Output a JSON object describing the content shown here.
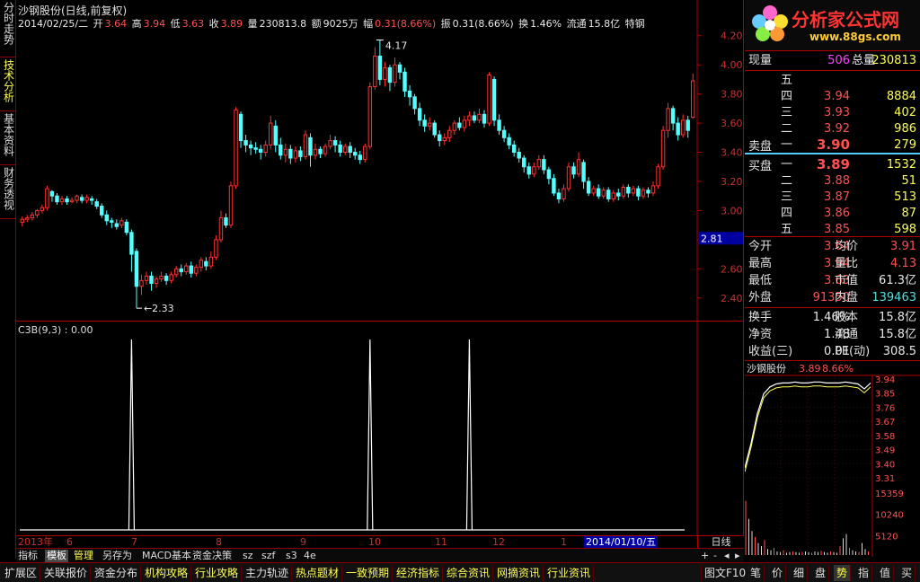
{
  "left_tabs": [
    "分时走势",
    "技术分析",
    "基本资料",
    "财务透视"
  ],
  "header": {
    "title": "沙钢股份(日线,前复权)",
    "date": "2014/02/25/二",
    "open_label": "开",
    "open": "3.64",
    "high_label": "高",
    "high": "3.94",
    "low_label": "低",
    "low": "3.63",
    "close_label": "收",
    "close": "3.89",
    "volume_label": "量",
    "volume": "230813.8",
    "amount_label": "额",
    "amount": "9025万",
    "range_label": "幅",
    "range": "0.31(8.66%)",
    "amplitude_label": "振",
    "amplitude": "0.31(8.66%)",
    "turnover_label": "换",
    "turnover": "1.46%",
    "float_label": "流通",
    "float": "15.8亿",
    "sector": "特钢"
  },
  "kline": {
    "price_axis": [
      "4.20",
      "4.00",
      "3.80",
      "3.60",
      "3.40",
      "3.20",
      "3.00",
      "2.80",
      "2.60",
      "2.40"
    ],
    "ylim": [
      2.3,
      4.26
    ],
    "high_mark": "4.17",
    "low_mark": "2.33",
    "cursor_price": "2.81",
    "candles": [
      [
        2.92,
        2.94,
        2.96,
        2.89
      ],
      [
        2.94,
        2.95,
        2.97,
        2.92
      ],
      [
        2.95,
        2.97,
        2.99,
        2.93
      ],
      [
        2.97,
        3.0,
        3.01,
        2.95
      ],
      [
        3.0,
        3.02,
        3.04,
        2.98
      ],
      [
        3.02,
        3.15,
        3.17,
        3.0
      ],
      [
        3.13,
        3.1,
        3.14,
        3.06
      ],
      [
        3.1,
        3.06,
        3.12,
        3.04
      ],
      [
        3.06,
        3.08,
        3.1,
        3.04
      ],
      [
        3.08,
        3.06,
        3.1,
        3.04
      ],
      [
        3.06,
        3.07,
        3.09,
        3.05
      ],
      [
        3.07,
        3.1,
        3.11,
        3.05
      ],
      [
        3.09,
        3.07,
        3.11,
        3.05
      ],
      [
        3.07,
        3.09,
        3.11,
        3.05
      ],
      [
        3.08,
        3.07,
        3.1,
        3.04
      ],
      [
        3.06,
        3.03,
        3.08,
        3.01
      ],
      [
        3.03,
        2.97,
        3.05,
        2.95
      ],
      [
        2.97,
        2.93,
        3.0,
        2.9
      ],
      [
        2.93,
        2.92,
        2.95,
        2.88
      ],
      [
        2.91,
        2.89,
        2.94,
        2.87
      ],
      [
        2.9,
        2.93,
        2.95,
        2.88
      ],
      [
        2.92,
        2.85,
        2.94,
        2.83
      ],
      [
        2.85,
        2.7,
        2.87,
        2.58
      ],
      [
        2.72,
        2.48,
        2.74,
        2.33
      ],
      [
        2.48,
        2.52,
        2.56,
        2.42
      ],
      [
        2.52,
        2.55,
        2.58,
        2.49
      ],
      [
        2.55,
        2.5,
        2.58,
        2.45
      ],
      [
        2.5,
        2.53,
        2.55,
        2.47
      ],
      [
        2.53,
        2.55,
        2.58,
        2.51
      ],
      [
        2.55,
        2.52,
        2.57,
        2.49
      ],
      [
        2.52,
        2.56,
        2.58,
        2.5
      ],
      [
        2.56,
        2.6,
        2.62,
        2.54
      ],
      [
        2.6,
        2.58,
        2.63,
        2.55
      ],
      [
        2.58,
        2.62,
        2.64,
        2.56
      ],
      [
        2.62,
        2.57,
        2.65,
        2.54
      ],
      [
        2.57,
        2.61,
        2.63,
        2.55
      ],
      [
        2.61,
        2.66,
        2.68,
        2.58
      ],
      [
        2.65,
        2.62,
        2.68,
        2.59
      ],
      [
        2.62,
        2.68,
        2.72,
        2.6
      ],
      [
        2.68,
        2.8,
        2.83,
        2.66
      ],
      [
        2.8,
        2.95,
        3.0,
        2.78
      ],
      [
        2.95,
        2.9,
        2.98,
        2.88
      ],
      [
        2.9,
        3.17,
        3.2,
        2.88
      ],
      [
        3.17,
        3.69,
        3.71,
        3.15
      ],
      [
        3.66,
        3.48,
        3.68,
        3.43
      ],
      [
        3.48,
        3.45,
        3.52,
        3.4
      ],
      [
        3.45,
        3.43,
        3.48,
        3.38
      ],
      [
        3.43,
        3.42,
        3.47,
        3.39
      ],
      [
        3.42,
        3.4,
        3.45,
        3.35
      ],
      [
        3.4,
        3.45,
        3.48,
        3.37
      ],
      [
        3.45,
        3.6,
        3.65,
        3.42
      ],
      [
        3.58,
        3.45,
        3.62,
        3.4
      ],
      [
        3.45,
        3.38,
        3.5,
        3.35
      ],
      [
        3.38,
        3.42,
        3.46,
        3.33
      ],
      [
        3.42,
        3.36,
        3.45,
        3.32
      ],
      [
        3.36,
        3.41,
        3.44,
        3.33
      ],
      [
        3.41,
        3.37,
        3.44,
        3.34
      ],
      [
        3.37,
        3.52,
        3.55,
        3.35
      ],
      [
        3.5,
        3.38,
        3.53,
        3.3
      ],
      [
        3.38,
        3.42,
        3.46,
        3.35
      ],
      [
        3.42,
        3.39,
        3.44,
        3.36
      ],
      [
        3.39,
        3.44,
        3.46,
        3.37
      ],
      [
        3.44,
        3.48,
        3.52,
        3.42
      ],
      [
        3.48,
        3.45,
        3.51,
        3.4
      ],
      [
        3.45,
        3.4,
        3.48,
        3.37
      ],
      [
        3.4,
        3.44,
        3.46,
        3.38
      ],
      [
        3.44,
        3.4,
        3.47,
        3.36
      ],
      [
        3.4,
        3.38,
        3.43,
        3.35
      ],
      [
        3.38,
        3.35,
        3.41,
        3.32
      ],
      [
        3.35,
        3.44,
        3.46,
        3.33
      ],
      [
        3.44,
        3.85,
        3.88,
        3.42
      ],
      [
        3.85,
        4.06,
        4.12,
        3.83
      ],
      [
        4.06,
        3.9,
        4.17,
        3.86
      ],
      [
        3.9,
        3.98,
        4.02,
        3.85
      ],
      [
        3.98,
        3.88,
        4.0,
        3.82
      ],
      [
        3.88,
        4.0,
        4.05,
        3.85
      ],
      [
        4.0,
        3.95,
        4.02,
        3.9
      ],
      [
        3.95,
        3.82,
        3.98,
        3.78
      ],
      [
        3.82,
        3.78,
        3.86,
        3.72
      ],
      [
        3.78,
        3.7,
        3.8,
        3.66
      ],
      [
        3.7,
        3.62,
        3.74,
        3.58
      ],
      [
        3.62,
        3.58,
        3.66,
        3.54
      ],
      [
        3.58,
        3.6,
        3.64,
        3.55
      ],
      [
        3.6,
        3.52,
        3.62,
        3.5
      ],
      [
        3.52,
        3.48,
        3.55,
        3.44
      ],
      [
        3.48,
        3.5,
        3.53,
        3.45
      ],
      [
        3.5,
        3.55,
        3.58,
        3.47
      ],
      [
        3.55,
        3.6,
        3.62,
        3.52
      ],
      [
        3.6,
        3.57,
        3.64,
        3.55
      ],
      [
        3.57,
        3.62,
        3.65,
        3.54
      ],
      [
        3.62,
        3.65,
        3.68,
        3.58
      ],
      [
        3.65,
        3.62,
        3.68,
        3.6
      ],
      [
        3.62,
        3.66,
        3.7,
        3.6
      ],
      [
        3.66,
        3.6,
        3.69,
        3.57
      ],
      [
        3.6,
        3.93,
        3.95,
        3.58
      ],
      [
        3.9,
        3.62,
        3.92,
        3.58
      ],
      [
        3.62,
        3.55,
        3.66,
        3.52
      ],
      [
        3.55,
        3.5,
        3.58,
        3.47
      ],
      [
        3.5,
        3.45,
        3.53,
        3.42
      ],
      [
        3.45,
        3.4,
        3.48,
        3.37
      ],
      [
        3.4,
        3.36,
        3.43,
        3.33
      ],
      [
        3.36,
        3.3,
        3.38,
        3.26
      ],
      [
        3.3,
        3.25,
        3.33,
        3.22
      ],
      [
        3.25,
        3.3,
        3.33,
        3.23
      ],
      [
        3.3,
        3.35,
        3.38,
        3.28
      ],
      [
        3.35,
        3.28,
        3.38,
        3.25
      ],
      [
        3.28,
        3.22,
        3.3,
        3.18
      ],
      [
        3.22,
        3.12,
        3.25,
        3.1
      ],
      [
        3.12,
        3.08,
        3.15,
        3.05
      ],
      [
        3.08,
        3.15,
        3.18,
        3.06
      ],
      [
        3.15,
        3.3,
        3.33,
        3.13
      ],
      [
        3.3,
        3.25,
        3.33,
        3.22
      ],
      [
        3.25,
        3.35,
        3.4,
        3.23
      ],
      [
        3.33,
        3.2,
        3.35,
        3.15
      ],
      [
        3.2,
        3.12,
        3.23,
        3.1
      ],
      [
        3.12,
        3.15,
        3.17,
        3.1
      ],
      [
        3.15,
        3.1,
        3.18,
        3.08
      ],
      [
        3.1,
        3.14,
        3.16,
        3.08
      ],
      [
        3.14,
        3.08,
        3.16,
        3.06
      ],
      [
        3.08,
        3.12,
        3.14,
        3.06
      ],
      [
        3.12,
        3.1,
        3.15,
        3.07
      ],
      [
        3.1,
        3.16,
        3.18,
        3.08
      ],
      [
        3.16,
        3.12,
        3.18,
        3.09
      ],
      [
        3.12,
        3.15,
        3.17,
        3.1
      ],
      [
        3.15,
        3.1,
        3.17,
        3.07
      ],
      [
        3.1,
        3.14,
        3.16,
        3.08
      ],
      [
        3.14,
        3.12,
        3.16,
        3.09
      ],
      [
        3.12,
        3.17,
        3.2,
        3.1
      ],
      [
        3.17,
        3.3,
        3.32,
        3.15
      ],
      [
        3.3,
        3.55,
        3.58,
        3.28
      ],
      [
        3.55,
        3.7,
        3.74,
        3.5
      ],
      [
        3.7,
        3.6,
        3.72,
        3.55
      ],
      [
        3.6,
        3.52,
        3.64,
        3.48
      ],
      [
        3.52,
        3.62,
        3.66,
        3.5
      ],
      [
        3.62,
        3.55,
        3.65,
        3.5
      ],
      [
        3.64,
        3.89,
        3.94,
        3.63
      ]
    ]
  },
  "indicator": {
    "label": "C3B(9,3) : 0.00",
    "spikes": [
      22,
      70,
      90
    ]
  },
  "time_axis": {
    "labels": [
      "2013年",
      "6",
      "7",
      "8",
      "9",
      "10",
      "11",
      "12",
      "1"
    ],
    "selected": "2014/01/10/五",
    "period": "日线"
  },
  "toolbar1": [
    "指标",
    "模板",
    "管理",
    "另存为",
    "MACD基本",
    "资金决策",
    "sz",
    "szf",
    "s3",
    "4e"
  ],
  "toolbar2": [
    "扩展区",
    "关联报价",
    "资金分布",
    "机构攻略",
    "行业攻略",
    "主力轨迹",
    "热点题材",
    "一致预期",
    "经济指标",
    "综合资讯",
    "网摘资讯",
    "行业资讯"
  ],
  "toolbar2_right": "图文F10",
  "right_tabs": [
    "笔",
    "价",
    "细",
    "盘",
    "势",
    "指",
    "值",
    "买"
  ],
  "logo": {
    "name": "分析家公式网",
    "url": "www.88gs.com"
  },
  "quote": {
    "xianliang_label": "现量",
    "xianliang": "506",
    "zongliang_label": "总量",
    "zongliang": "230813",
    "sell": [
      {
        "label": "五",
        "price": "",
        "vol": ""
      },
      {
        "label": "四",
        "price": "3.94",
        "vol": "8884"
      },
      {
        "label": "三",
        "price": "3.93",
        "vol": "402"
      },
      {
        "label": "二",
        "price": "3.92",
        "vol": "986"
      },
      {
        "label": "一",
        "price": "3.90",
        "vol": "279"
      }
    ],
    "sell_title": "卖盘",
    "buy_title": "买盘",
    "buy": [
      {
        "label": "一",
        "price": "3.89",
        "vol": "1532"
      },
      {
        "label": "二",
        "price": "3.88",
        "vol": "51"
      },
      {
        "label": "三",
        "price": "3.87",
        "vol": "513"
      },
      {
        "label": "四",
        "price": "3.86",
        "vol": "87"
      },
      {
        "label": "五",
        "price": "3.85",
        "vol": "598"
      }
    ],
    "stats": [
      {
        "l1": "今开",
        "v1": "3.64",
        "l2": "均价",
        "v2": "3.91"
      },
      {
        "l1": "最高",
        "v1": "3.94",
        "l2": "量比",
        "v2": "4.13"
      },
      {
        "l1": "最低",
        "v1": "3.63",
        "l2": "市值",
        "v2": "61.3亿"
      },
      {
        "l1": "外盘",
        "v1": "91350",
        "l2": "内盘",
        "v2": "139463"
      }
    ],
    "fund": [
      {
        "l1": "换手",
        "v1": "1.46%",
        "l2": "股本",
        "v2": "15.8亿"
      },
      {
        "l1": "净资",
        "v1": "1.48",
        "l2": "流通",
        "v2": "15.8亿"
      },
      {
        "l1": "收益(三)",
        "v1": "0.01",
        "l2": "PE(动)",
        "v2": "308.5"
      }
    ]
  },
  "mini": {
    "title": "沙钢股份",
    "price": "3.89",
    "pct": "8.66%",
    "price_axis": [
      "3.94",
      "3.85",
      "3.76",
      "3.67",
      "3.58",
      "3.49",
      "3.40",
      "3.31"
    ],
    "vol_axis": [
      "15359",
      "10240",
      "5120"
    ]
  },
  "colors": {
    "up": "#ff3030",
    "down": "#54ffff",
    "frame": "#b00000"
  }
}
